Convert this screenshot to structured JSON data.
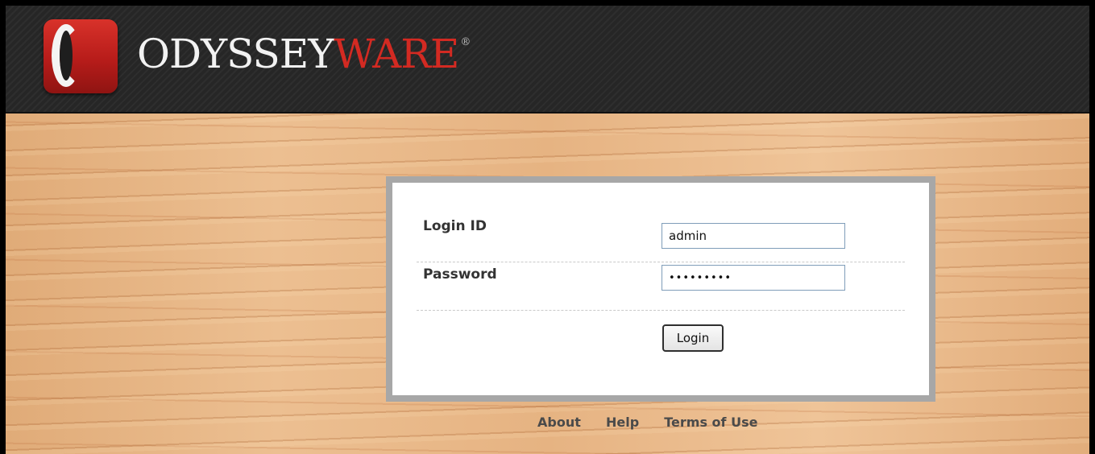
{
  "brand": {
    "name_part1": "ODYSSEY",
    "name_part2": "WARE",
    "registered": "®",
    "accent_color": "#d32a22"
  },
  "login_form": {
    "login_id_label": "Login ID",
    "login_id_value": "admin",
    "password_label": "Password",
    "password_value": "•••••••••",
    "login_button_label": "Login"
  },
  "footer": {
    "links": [
      "About",
      "Help",
      "Terms of Use"
    ]
  }
}
